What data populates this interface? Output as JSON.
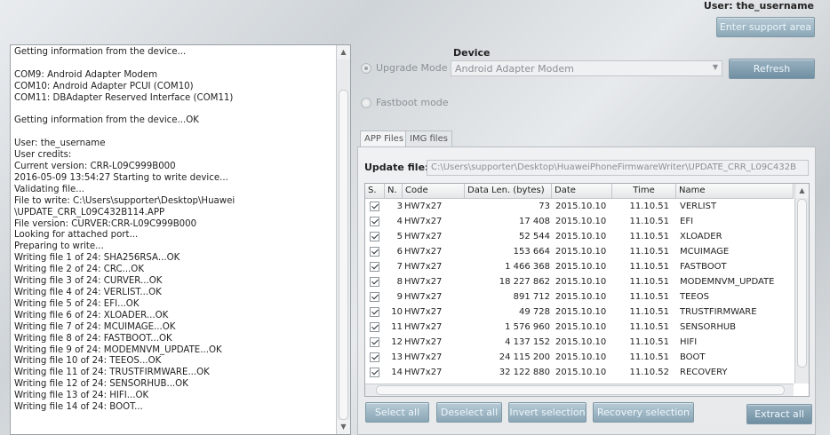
{
  "header": {
    "user_label": "User: the_username",
    "support_button": "Enter support area"
  },
  "log": {
    "lines": [
      "Getting information from the device...",
      "",
      "COM9: Android Adapter Modem",
      "COM10: Android Adapter PCUI (COM10)",
      "COM11: DBAdapter Reserved Interface (COM11)",
      "",
      "Getting information from the device...OK",
      "",
      "User: the_username",
      "User credits:",
      "Current version: CRR-L09C999B000",
      "2016-05-09 13:54:27 Starting to write device...",
      "Validating file...",
      "File to write: C:\\Users\\supporter\\Desktop\\Huawei",
      "\\UPDATE_CRR_L09C432B114.APP",
      "File version: CURVER:CRR-L09C999B000",
      "Looking for attached port...",
      "Preparing to write...",
      "Writing file 1 of 24: SHA256RSA...OK",
      "Writing file 2 of 24: CRC...OK",
      "Writing file 3 of 24: CURVER...OK",
      "Writing file 4 of 24: VERLIST...OK",
      "Writing file 5 of 24: EFI...OK",
      "Writing file 6 of 24: XLOADER...OK",
      "Writing file 7 of 24: MCUIMAGE...OK",
      "Writing file 8 of 24: FASTBOOT...OK",
      "Writing file 9 of 24: MODEMNVM_UPDATE...OK",
      "Writing file 10 of 24: TEEOS...OK",
      "Writing file 11 of 24: TRUSTFIRMWARE...OK",
      "Writing file 12 of 24: SENSORHUB...OK",
      "Writing file 13 of 24: HIFI...OK",
      "Writing file 14 of 24: BOOT..."
    ]
  },
  "device": {
    "label": "Device",
    "upgrade_mode": "Upgrade Mode",
    "fastboot_mode": "Fastboot mode",
    "selected": "Android Adapter Modem",
    "refresh": "Refresh"
  },
  "tabs": [
    {
      "label": "APP Files"
    },
    {
      "label": "IMG files"
    }
  ],
  "update_file": {
    "label": "Update file:",
    "path": "C:\\Users\\supporter\\Desktop\\HuaweiPhoneFirmwareWriter\\UPDATE_CRR_L09C432B"
  },
  "table": {
    "headers": {
      "s": "S.",
      "n": "N.",
      "code": "Code",
      "len": "Data Len. (bytes)",
      "date": "Date",
      "time": "Time",
      "name": "Name"
    },
    "rows": [
      {
        "checked": true,
        "n": "3",
        "code": "HW7x27",
        "len": "73",
        "date": "2015.10.10",
        "time": "11.10.51",
        "name": "VERLIST"
      },
      {
        "checked": true,
        "n": "4",
        "code": "HW7x27",
        "len": "17 408",
        "date": "2015.10.10",
        "time": "11.10.51",
        "name": "EFI"
      },
      {
        "checked": true,
        "n": "5",
        "code": "HW7x27",
        "len": "52 544",
        "date": "2015.10.10",
        "time": "11.10.51",
        "name": "XLOADER"
      },
      {
        "checked": true,
        "n": "6",
        "code": "HW7x27",
        "len": "153 664",
        "date": "2015.10.10",
        "time": "11.10.51",
        "name": "MCUIMAGE"
      },
      {
        "checked": true,
        "n": "7",
        "code": "HW7x27",
        "len": "1 466 368",
        "date": "2015.10.10",
        "time": "11.10.51",
        "name": "FASTBOOT"
      },
      {
        "checked": true,
        "n": "8",
        "code": "HW7x27",
        "len": "18 227 862",
        "date": "2015.10.10",
        "time": "11.10.51",
        "name": "MODEMNVM_UPDATE"
      },
      {
        "checked": true,
        "n": "9",
        "code": "HW7x27",
        "len": "891 712",
        "date": "2015.10.10",
        "time": "11.10.51",
        "name": "TEEOS"
      },
      {
        "checked": true,
        "n": "10",
        "code": "HW7x27",
        "len": "49 728",
        "date": "2015.10.10",
        "time": "11.10.51",
        "name": "TRUSTFIRMWARE"
      },
      {
        "checked": true,
        "n": "11",
        "code": "HW7x27",
        "len": "1 576 960",
        "date": "2015.10.10",
        "time": "11.10.51",
        "name": "SENSORHUB"
      },
      {
        "checked": true,
        "n": "12",
        "code": "HW7x27",
        "len": "4 137 152",
        "date": "2015.10.10",
        "time": "11.10.51",
        "name": "HIFI"
      },
      {
        "checked": true,
        "n": "13",
        "code": "HW7x27",
        "len": "24 115 200",
        "date": "2015.10.10",
        "time": "11.10.51",
        "name": "BOOT"
      },
      {
        "checked": true,
        "n": "14",
        "code": "HW7x27",
        "len": "32 122 880",
        "date": "2015.10.10",
        "time": "11.10.52",
        "name": "RECOVERY"
      }
    ]
  },
  "actions": {
    "select_all": "Select all",
    "deselect_all": "Deselect all",
    "invert_selection": "Invert selection",
    "recovery_selection": "Recovery selection",
    "extract_all": "Extract all"
  },
  "colors": {
    "button": "#8aa6b6",
    "button_text": "#eef6fb",
    "disabled_text": "#8b9196"
  },
  "icons": {
    "scroll_up": "triangle-up",
    "scroll_down": "triangle-down",
    "combo_arrow": "triangle-down"
  }
}
